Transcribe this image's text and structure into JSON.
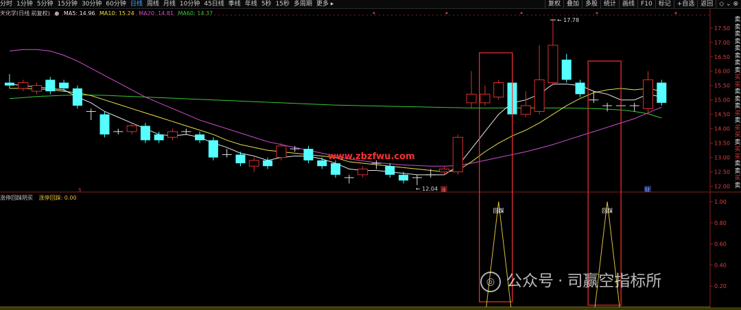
{
  "toolbar": {
    "periods": [
      "分时",
      "1分钟",
      "5分钟",
      "15分钟",
      "30分钟",
      "60分钟",
      "日线",
      "周线",
      "月线",
      "10分钟",
      "45日线",
      "季线",
      "年线",
      "5秒",
      "15秒",
      "多周期",
      "更多"
    ],
    "active_period": "日线",
    "tools": [
      "复权",
      "叠加",
      "多股",
      "统计",
      "画线",
      "F10",
      "标记",
      "+自选",
      "返回"
    ],
    "window_icons": "◇ ⌄ ⊗"
  },
  "legend": {
    "stock": "天化学(日线 前复权)",
    "ma5": "MA5: 14.96",
    "ma10": "MA10: 15.24",
    "ma20": "MA20: 14.81",
    "ma60": "MA60: 14.37"
  },
  "indicator": {
    "title": "涨停回踩阴买",
    "name_value": "涨停回踩: 0.00",
    "label": "回踩"
  },
  "annotations": {
    "high": "17.78",
    "low": "12.04",
    "mark_s": "S",
    "mark_zhang": "涨",
    "mark_cai": "财"
  },
  "price_axis": [
    "17.50",
    "17.00",
    "16.50",
    "16.00",
    "15.50",
    "15.00",
    "14.50",
    "14.00",
    "13.50",
    "13.00",
    "12.50",
    "12.00"
  ],
  "ind_axis": [
    "1.00",
    "0.80",
    "0.60",
    "0.40",
    "0.20"
  ],
  "signals": [
    "卖",
    "卖",
    "卖",
    "卖",
    "卖",
    "卖",
    "卖",
    "卖",
    "买",
    "买",
    "卖",
    "卖",
    "卖",
    "买",
    "卖",
    "买",
    "买",
    "卖",
    "买",
    "买",
    "卖",
    "卖",
    "买",
    "卖"
  ],
  "watermark": {
    "site": "www.zbzfwu.com",
    "account": "公众号",
    "dot": "·",
    "name": "司赢空指标所"
  },
  "colors": {
    "up": "#e03030",
    "down": "#55ffff",
    "ma5": "#e8e8e8",
    "ma10": "#e8e04a",
    "ma20": "#d04fd0",
    "ma60": "#38c838"
  },
  "chart_data": {
    "type": "candlestick",
    "ylim": [
      11.8,
      17.9
    ],
    "candles": [
      {
        "o": 15.6,
        "c": 15.5,
        "h": 15.9,
        "l": 15.4
      },
      {
        "o": 15.4,
        "c": 15.6,
        "h": 15.7,
        "l": 15.3
      },
      {
        "o": 15.3,
        "c": 15.5,
        "h": 15.6,
        "l": 15.2
      },
      {
        "o": 15.7,
        "c": 15.3,
        "h": 15.8,
        "l": 15.2
      },
      {
        "o": 15.6,
        "c": 15.4,
        "h": 15.7,
        "l": 15.3
      },
      {
        "o": 15.4,
        "c": 14.8,
        "h": 15.5,
        "l": 14.7
      },
      {
        "o": 14.6,
        "c": 14.6,
        "h": 14.7,
        "l": 14.3
      },
      {
        "o": 14.5,
        "c": 13.8,
        "h": 14.6,
        "l": 13.7
      },
      {
        "o": 13.9,
        "c": 13.9,
        "h": 14.0,
        "l": 13.8
      },
      {
        "o": 13.9,
        "c": 14.1,
        "h": 14.2,
        "l": 13.8
      },
      {
        "o": 14.1,
        "c": 13.6,
        "h": 14.2,
        "l": 13.5
      },
      {
        "o": 13.8,
        "c": 13.6,
        "h": 13.9,
        "l": 13.5
      },
      {
        "o": 13.7,
        "c": 13.9,
        "h": 14.0,
        "l": 13.6
      },
      {
        "o": 13.9,
        "c": 13.9,
        "h": 14.0,
        "l": 13.8
      },
      {
        "o": 13.8,
        "c": 13.6,
        "h": 13.9,
        "l": 13.5
      },
      {
        "o": 13.6,
        "c": 13.0,
        "h": 13.7,
        "l": 12.9
      },
      {
        "o": 13.1,
        "c": 13.1,
        "h": 13.3,
        "l": 13.0
      },
      {
        "o": 13.1,
        "c": 12.8,
        "h": 13.2,
        "l": 12.7
      },
      {
        "o": 12.7,
        "c": 12.9,
        "h": 13.0,
        "l": 12.5
      },
      {
        "o": 12.9,
        "c": 12.7,
        "h": 13.0,
        "l": 12.6
      },
      {
        "o": 13.0,
        "c": 13.4,
        "h": 13.5,
        "l": 12.9
      },
      {
        "o": 13.3,
        "c": 13.3,
        "h": 13.4,
        "l": 13.2
      },
      {
        "o": 13.3,
        "c": 12.9,
        "h": 13.4,
        "l": 12.8
      },
      {
        "o": 12.9,
        "c": 12.7,
        "h": 13.0,
        "l": 12.6
      },
      {
        "o": 12.8,
        "c": 12.4,
        "h": 12.9,
        "l": 12.3
      },
      {
        "o": 12.3,
        "c": 12.3,
        "h": 12.4,
        "l": 12.1
      },
      {
        "o": 12.4,
        "c": 12.6,
        "h": 12.7,
        "l": 12.3
      },
      {
        "o": 12.8,
        "c": 12.8,
        "h": 12.9,
        "l": 12.6
      },
      {
        "o": 12.7,
        "c": 12.4,
        "h": 12.8,
        "l": 12.3
      },
      {
        "o": 12.4,
        "c": 12.2,
        "h": 12.5,
        "l": 12.1
      },
      {
        "o": 12.3,
        "c": 12.3,
        "h": 12.4,
        "l": 12.04
      },
      {
        "o": 12.4,
        "c": 12.4,
        "h": 12.6,
        "l": 12.3
      },
      {
        "o": 12.5,
        "c": 12.6,
        "h": 12.7,
        "l": 12.4
      },
      {
        "o": 12.5,
        "c": 13.7,
        "h": 13.8,
        "l": 12.4
      },
      {
        "o": 14.9,
        "c": 15.2,
        "h": 16.0,
        "l": 14.7
      },
      {
        "o": 14.9,
        "c": 15.2,
        "h": 15.5,
        "l": 14.8
      },
      {
        "o": 15.1,
        "c": 15.6,
        "h": 15.7,
        "l": 15.0
      },
      {
        "o": 15.6,
        "c": 14.5,
        "h": 15.7,
        "l": 14.4
      },
      {
        "o": 14.5,
        "c": 14.8,
        "h": 15.3,
        "l": 14.4
      },
      {
        "o": 14.6,
        "c": 15.7,
        "h": 16.9,
        "l": 14.5
      },
      {
        "o": 15.6,
        "c": 16.9,
        "h": 17.78,
        "l": 15.5
      },
      {
        "o": 16.4,
        "c": 15.7,
        "h": 16.6,
        "l": 15.6
      },
      {
        "o": 15.6,
        "c": 15.2,
        "h": 15.7,
        "l": 15.1
      },
      {
        "o": 15.0,
        "c": 15.0,
        "h": 15.3,
        "l": 14.9
      },
      {
        "o": 14.8,
        "c": 14.8,
        "h": 14.9,
        "l": 14.6
      },
      {
        "o": 14.8,
        "c": 14.8,
        "h": 14.9,
        "l": 14.7
      },
      {
        "o": 14.8,
        "c": 14.8,
        "h": 14.9,
        "l": 14.6
      },
      {
        "o": 14.7,
        "c": 15.7,
        "h": 16.0,
        "l": 14.5
      },
      {
        "o": 15.6,
        "c": 14.9,
        "h": 15.7,
        "l": 14.8
      }
    ],
    "ma5": [
      15.55,
      15.5,
      15.45,
      15.4,
      15.35,
      15.1,
      14.9,
      14.6,
      14.4,
      14.2,
      14.0,
      13.8,
      13.75,
      13.8,
      13.7,
      13.5,
      13.35,
      13.15,
      13.05,
      12.9,
      13.0,
      13.05,
      13.05,
      12.95,
      12.8,
      12.6,
      12.55,
      12.55,
      12.5,
      12.45,
      12.4,
      12.4,
      12.4,
      12.7,
      13.3,
      13.9,
      14.5,
      14.9,
      15.0,
      15.2,
      15.55,
      15.55,
      15.5,
      15.3,
      15.2,
      15.0,
      15.0,
      15.2,
      15.1
    ],
    "ma10": [
      15.4,
      15.4,
      15.38,
      15.36,
      15.3,
      15.25,
      15.15,
      15.0,
      14.85,
      14.7,
      14.55,
      14.4,
      14.25,
      14.1,
      13.95,
      13.8,
      13.6,
      13.45,
      13.35,
      13.25,
      13.2,
      13.15,
      13.1,
      13.05,
      13.0,
      12.85,
      12.8,
      12.75,
      12.7,
      12.65,
      12.6,
      12.55,
      12.5,
      12.55,
      12.85,
      13.2,
      13.5,
      13.75,
      13.95,
      14.2,
      14.5,
      14.8,
      15.05,
      15.25,
      15.35,
      15.4,
      15.35,
      15.4,
      15.3
    ],
    "ma20": [
      16.7,
      16.75,
      16.75,
      16.7,
      16.55,
      16.35,
      16.1,
      15.85,
      15.6,
      15.35,
      15.1,
      14.9,
      14.7,
      14.5,
      14.3,
      14.15,
      14.0,
      13.85,
      13.7,
      13.55,
      13.45,
      13.35,
      13.25,
      13.15,
      13.05,
      12.95,
      12.88,
      12.82,
      12.78,
      12.74,
      12.72,
      12.7,
      12.7,
      12.72,
      12.8,
      12.9,
      13.0,
      13.1,
      13.2,
      13.32,
      13.45,
      13.6,
      13.75,
      13.9,
      14.05,
      14.2,
      14.35,
      14.55,
      14.75
    ],
    "ma60": [
      15.05,
      15.08,
      15.12,
      15.14,
      15.16,
      15.17,
      15.17,
      15.16,
      15.14,
      15.12,
      15.1,
      15.08,
      15.06,
      15.04,
      15.02,
      15.0,
      14.98,
      14.96,
      14.94,
      14.92,
      14.9,
      14.88,
      14.86,
      14.84,
      14.82,
      14.81,
      14.8,
      14.79,
      14.78,
      14.77,
      14.76,
      14.75,
      14.74,
      14.73,
      14.72,
      14.72,
      14.72,
      14.72,
      14.72,
      14.72,
      14.72,
      14.72,
      14.71,
      14.7,
      14.68,
      14.65,
      14.6,
      14.52,
      14.37
    ],
    "indicator_values": [
      0,
      0,
      0,
      0,
      0,
      0,
      0,
      0,
      0,
      0,
      0,
      0,
      0,
      0,
      0,
      0,
      0,
      0,
      0,
      0,
      0,
      0,
      0,
      0,
      0,
      0,
      0,
      0,
      0,
      0,
      0,
      0,
      0,
      0,
      0,
      0,
      1,
      0,
      0,
      0,
      0,
      0,
      0,
      0,
      1,
      0,
      0,
      0,
      0
    ],
    "signal_indices": [
      36,
      44
    ],
    "ind_ylim": [
      0,
      1.0
    ]
  }
}
